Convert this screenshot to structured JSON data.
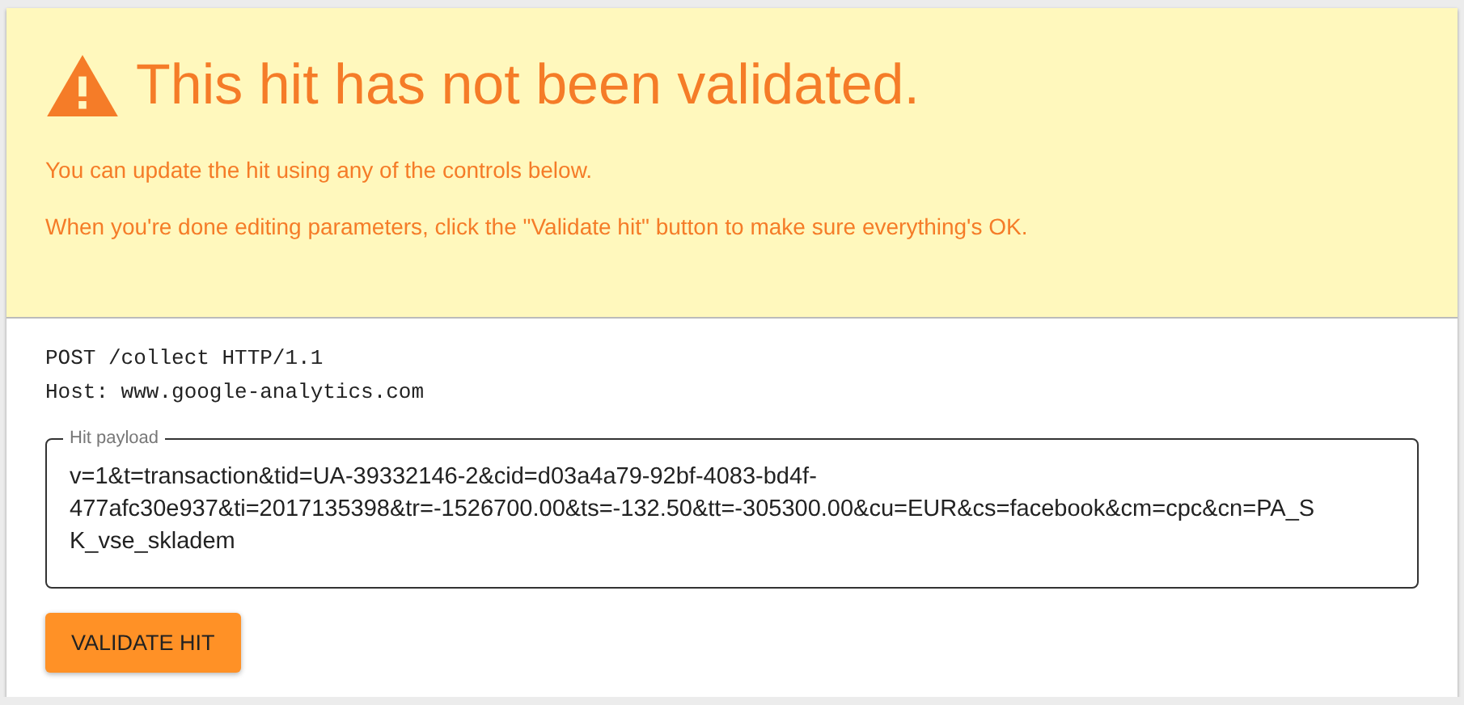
{
  "banner": {
    "title": "This hit has not been validated.",
    "messages": [
      "You can update the hit using any of the controls below.",
      "When you're done editing parameters, click the \"Validate hit\" button to make sure everything's OK."
    ]
  },
  "request": {
    "lines": [
      "POST /collect HTTP/1.1",
      "Host: www.google-analytics.com"
    ]
  },
  "payload_field": {
    "label": "Hit payload",
    "value": "v=1&t=transaction&tid=UA-39332146-2&cid=d03a4a79-92bf-4083-bd4f-477afc30e937&ti=2017135398&tr=-1526700.00&ts=-132.50&tt=-305300.00&cu=EUR&cs=facebook&cm=cpc&cn=PA_SK_vse_skladem"
  },
  "buttons": [
    "VALIDATE HIT"
  ]
}
